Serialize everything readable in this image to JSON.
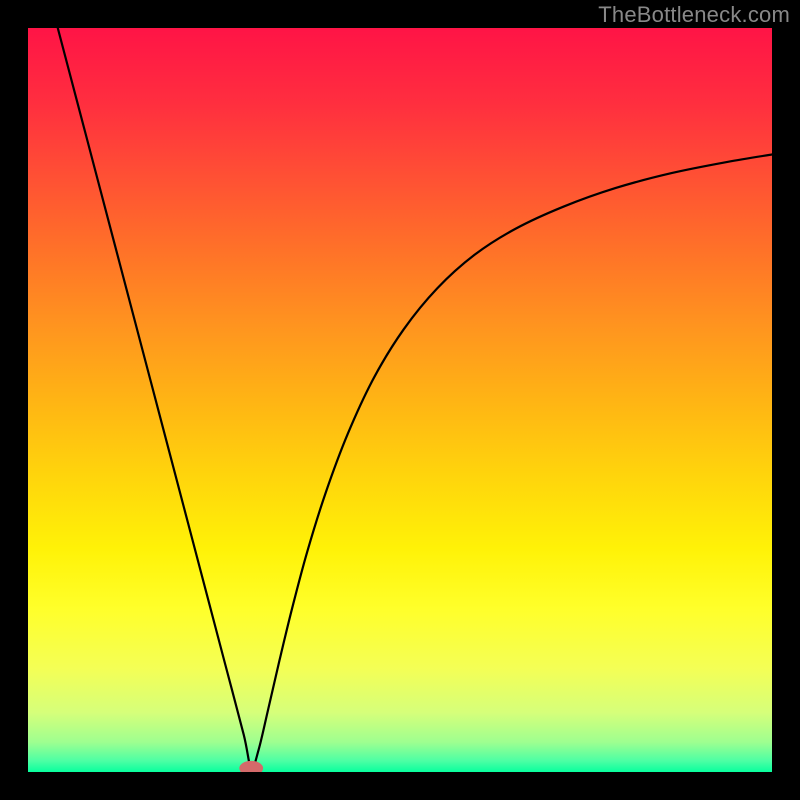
{
  "watermark": "TheBottleneck.com",
  "chart_data": {
    "type": "line",
    "title": "",
    "xlabel": "",
    "ylabel": "",
    "xlim": [
      0,
      100
    ],
    "ylim": [
      0,
      100
    ],
    "grid": false,
    "legend": false,
    "annotations": [],
    "background_gradient": {
      "type": "vertical",
      "stops": [
        {
          "pos": 0.0,
          "color": "#ff1446"
        },
        {
          "pos": 0.1,
          "color": "#ff2e3f"
        },
        {
          "pos": 0.2,
          "color": "#ff5034"
        },
        {
          "pos": 0.3,
          "color": "#ff7228"
        },
        {
          "pos": 0.4,
          "color": "#ff941f"
        },
        {
          "pos": 0.5,
          "color": "#ffb414"
        },
        {
          "pos": 0.6,
          "color": "#ffd40c"
        },
        {
          "pos": 0.7,
          "color": "#fff207"
        },
        {
          "pos": 0.78,
          "color": "#ffff2a"
        },
        {
          "pos": 0.86,
          "color": "#f4ff55"
        },
        {
          "pos": 0.92,
          "color": "#d6ff7a"
        },
        {
          "pos": 0.96,
          "color": "#9eff90"
        },
        {
          "pos": 0.985,
          "color": "#4dffa4"
        },
        {
          "pos": 1.0,
          "color": "#08ff9e"
        }
      ]
    },
    "marker": {
      "x": 30.0,
      "y": 0.5,
      "color": "#d46a6a",
      "rx": 1.6,
      "ry": 1.0
    },
    "series": [
      {
        "name": "curve",
        "color": "#000000",
        "x": [
          4.0,
          6.5,
          9.0,
          11.5,
          14.0,
          16.5,
          19.0,
          21.5,
          24.0,
          26.5,
          29.0,
          30.0,
          31.0,
          32.3,
          33.8,
          35.5,
          37.5,
          40.0,
          43.0,
          46.5,
          50.5,
          55.0,
          60.0,
          65.5,
          72.0,
          79.0,
          86.5,
          94.0,
          100.0
        ],
        "y": [
          100.0,
          90.5,
          81.0,
          71.5,
          62.0,
          52.5,
          43.0,
          33.5,
          24.0,
          14.5,
          5.0,
          0.5,
          3.0,
          8.5,
          15.0,
          22.0,
          29.5,
          37.5,
          45.5,
          53.0,
          59.5,
          65.0,
          69.5,
          73.0,
          76.0,
          78.5,
          80.5,
          82.0,
          83.0
        ]
      }
    ]
  }
}
